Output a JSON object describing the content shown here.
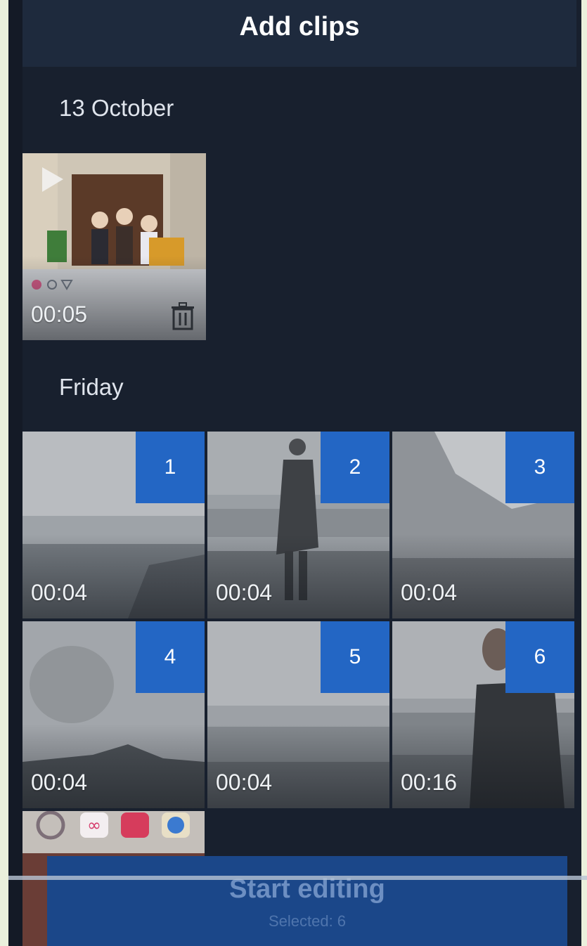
{
  "header": {
    "title": "Add clips"
  },
  "sections": [
    {
      "title": "13 October",
      "clips": [
        {
          "duration": "00:05"
        }
      ]
    },
    {
      "title": "Friday",
      "clips": [
        {
          "index": "1",
          "duration": "00:04"
        },
        {
          "index": "2",
          "duration": "00:04"
        },
        {
          "index": "3",
          "duration": "00:04"
        },
        {
          "index": "4",
          "duration": "00:04"
        },
        {
          "index": "5",
          "duration": "00:04"
        },
        {
          "index": "6",
          "duration": "00:16"
        }
      ]
    }
  ],
  "footer": {
    "button_label": "Start editing",
    "selected_text": "Selected: 6"
  },
  "colors": {
    "accent": "#2366c4",
    "background": "#18202e",
    "header": "#1e2a3d"
  }
}
